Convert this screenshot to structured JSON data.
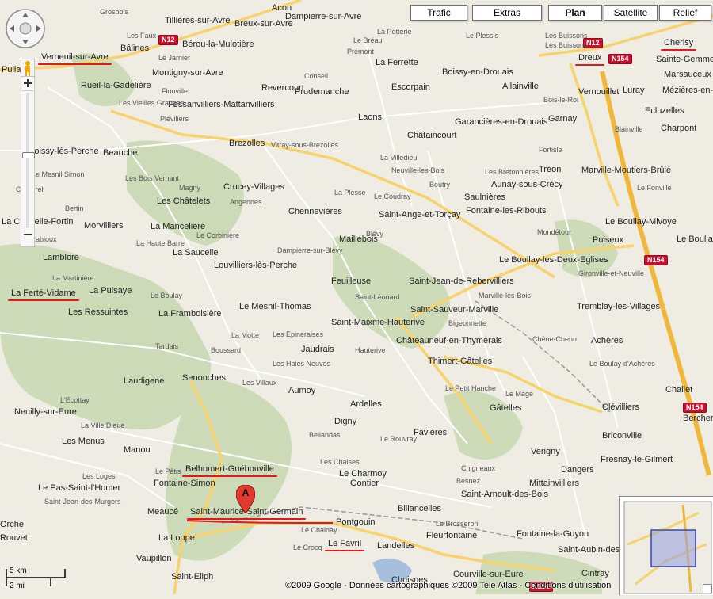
{
  "map_types": [
    {
      "label": "Trafic",
      "active": false
    },
    {
      "label": "Extras",
      "active": false
    },
    {
      "label": "Plan",
      "active": true
    },
    {
      "label": "Satellite",
      "active": false
    },
    {
      "label": "Relief",
      "active": false
    }
  ],
  "scale": {
    "km": "5 km",
    "mi": "2 mi"
  },
  "copyright": "©2009 Google - Données cartographiques ©2009 Tele Atlas - Conditions d'utilisation",
  "marker_label": "A",
  "road_shields": [
    "N12",
    "N12",
    "N154",
    "N154",
    "N154",
    "N154"
  ],
  "places_major": [
    "Verneuil-sur-Avre",
    "Bâlines",
    "Tillières-sur-Avre",
    "Breux-sur-Avre",
    "Acon",
    "Dampierre-sur-Avre",
    "Bérou-la-Mulotière",
    "Montigny-sur-Avre",
    "Rueil-la-Gadelière",
    "Fessanvilliers-Mattanvilliers",
    "Revercourt",
    "Prudemanche",
    "La Ferrette",
    "Escorpain",
    "Boissy-en-Drouais",
    "Dreux",
    "Cherisy",
    "Sainte-Gemme",
    "Marsauceux",
    "Mézières-en-Dr",
    "Vernouillet",
    "Luray",
    "Allainville",
    "Garancières-en-Drouais",
    "Garnay",
    "Ecluzelles",
    "Charpont",
    "Laons",
    "Châtaincourt",
    "Brezolles",
    "Beauche",
    "Boissy-lès-Perche",
    "Crucey-Villages",
    "Chennevières",
    "Saint-Ange-et-Torçay",
    "Fontaine-les-Ribouts",
    "Aunay-sous-Crécy",
    "Saulnières",
    "Tréon",
    "Marville-Moutiers-Brûlé",
    "Le Boullay-Mivoye",
    "Les Châtelets",
    "La Mancelière",
    "Morvilliers",
    "La Chapelle-Fortin",
    "Maillebois",
    "Le Boullay-les-Deux-Eglises",
    "Puiseux",
    "Le Boullay",
    "Lamblore",
    "La Saucelle",
    "Louvilliers-lès-Perche",
    "Feuilleuse",
    "Saint-Jean-de-Rebervilliers",
    "La Ferté-Vidame",
    "La Puisaye",
    "Le Mesnil-Thomas",
    "Saint-Sauveur-Marville",
    "Tremblay-les-Villages",
    "Les Ressuintes",
    "La Framboisière",
    "Saint-Maixme-Hauterive",
    "Jaudrais",
    "Châteauneuf-en-Thymerais",
    "Achères",
    "Thimert-Gâtelles",
    "Laudigene",
    "Senonches",
    "Aumoy",
    "Ardelles",
    "Gâtelles",
    "Challet",
    "Clévilliers",
    "Neuilly-sur-Eure",
    "Digny",
    "Favières",
    "Briconville",
    "Bercheres",
    "Les Menus",
    "Manou",
    "Verigny",
    "Fresnay-le-Gilmert",
    "Belhomert-Guéhouville",
    "Le Charmoy",
    "Gontier",
    "Dangers",
    "Fontaine-Simon",
    "Le Pas-Saint-l'Homer",
    "Mittainvilliers",
    "Saint-Maurice-Saint-Germain",
    "Meaucé",
    "Billancelles",
    "Saint-Arnoult-des-Bois",
    "Pontgouin",
    "La Loupe",
    "Fleurfontaine",
    "Fontaine-la-Guyon",
    "Saint-Aubin-des",
    "Le Favril",
    "Landelles",
    "Vaupillon",
    "Saint-Eliph",
    "Courville-sur-Eure",
    "Cintray",
    "Chuisnes",
    "Pulla",
    "Orche",
    "Rouvet"
  ],
  "places_minor": [
    "Grosbois",
    "Les Faux",
    "Le Jarnier",
    "Flouville",
    "Les Vieilles Granges",
    "Pléviliers",
    "Le Coudray",
    "Le Mesnil Simon",
    "Les Bois Vernant",
    "Cornerel",
    "Bertin",
    "Le Rabioux",
    "La Martinière",
    "Magny",
    "Angennes",
    "Le Corbinière",
    "La Haute Barre",
    "Dampierre-sur-Blévy",
    "Blévy",
    "Boutry",
    "Les Bretonnières",
    "Le Plessis",
    "Les Buissons",
    "Blainville",
    "Le Fonville",
    "Mondétour",
    "Gironville-et-Neuville",
    "Marville-les-Bois",
    "Bigeonnette",
    "Chêne-Chenu",
    "Le Boulay",
    "La Motte",
    "Les Epineraises",
    "Boussard",
    "Hauterive",
    "Les Haies Neuves",
    "Les Villaux",
    "Tardais",
    "Saint-Léonard",
    "Le Boulay-d'Achères",
    "L'Ecottay",
    "La Ville Dieue",
    "Le Petit Hanche",
    "Le Mage",
    "Bellandas",
    "Le Rouvray",
    "Les Chaises",
    "Chigneaux",
    "Besnez",
    "Les Loges",
    "Le Pâtis",
    "Saint-Jean-des-Murgers",
    "Le Chainay",
    "Le Brosseron",
    "Le Crocq",
    "La Villedieu",
    "Neuville-les-Bois",
    "La Plesse",
    "Vitray-sous-Brezolles",
    "Fortisle",
    "Bois-le-Roi",
    "La Potterie",
    "Prémont",
    "Les Buissons",
    "Le Bréau",
    "Conseil"
  ],
  "underlined_places": [
    "Verneuil-sur-Avre",
    "Dreux",
    "Cherisy",
    "La Ferté-Vidame",
    "Belhomert-Guéhouville",
    "Saint-Maurice-Saint-Germain",
    "Le Favril"
  ],
  "colors": {
    "land": "#efece4",
    "forest": "#cad9b3",
    "road_major": "#f7d36b",
    "road_minor": "#ffffff",
    "highway": "#f0b83a",
    "water": "#a5bfdd",
    "marker": "#e03a2e",
    "underline": "#e01a1a"
  }
}
